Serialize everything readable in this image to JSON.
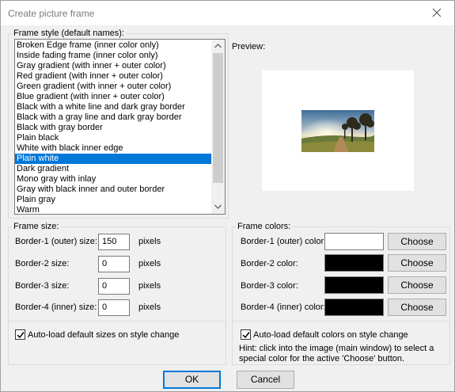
{
  "window": {
    "title": "Create picture frame",
    "close_icon": "close-icon"
  },
  "frame_style": {
    "legend": "Frame style (default names):",
    "selected_index": 11,
    "items": [
      "Broken Edge frame (inner color only)",
      "Inside fading frame (inner color only)",
      "Gray gradient (with inner + outer color)",
      "Red gradient (with inner + outer color)",
      "Green gradient (with inner + outer color)",
      "Blue gradient (with inner + outer color)",
      "Black with a white line and dark gray border",
      "Black with a gray line and dark gray border",
      "Black with gray border",
      "Plain black",
      "White with black inner edge",
      "Plain white",
      "Dark gradient",
      "Mono gray with inlay",
      "Gray with black inner and outer border",
      "Plain gray",
      "Warm"
    ]
  },
  "preview": {
    "label": "Preview:"
  },
  "frame_size": {
    "legend": "Frame size:",
    "unit": "pixels",
    "border1_label": "Border-1 (outer) size:",
    "border1_value": "150",
    "border2_label": "Border-2 size:",
    "border2_value": "0",
    "border3_label": "Border-3 size:",
    "border3_value": "0",
    "border4_label": "Border-4 (inner) size:",
    "border4_value": "0",
    "autoload_label": "Auto-load default sizes on style change",
    "autoload_checked": true
  },
  "frame_colors": {
    "legend": "Frame colors:",
    "border1_label": "Border-1 (outer) color:",
    "border1_color": "#ffffff",
    "border2_label": "Border-2 color:",
    "border2_color": "#000000",
    "border3_label": "Border-3 color:",
    "border3_color": "#000000",
    "border4_label": "Border-4 (inner) color:",
    "border4_color": "#000000",
    "choose_label": "Choose",
    "autoload_label": "Auto-load default colors on style change",
    "autoload_checked": true,
    "hint": "Hint: click into the image (main window) to select a special color for the active 'Choose' button."
  },
  "buttons": {
    "ok": "OK",
    "cancel": "Cancel"
  },
  "colors": {
    "selection": "#0078d7",
    "button_face": "#e1e1e1",
    "dialog_bg": "#f0f0f0"
  }
}
